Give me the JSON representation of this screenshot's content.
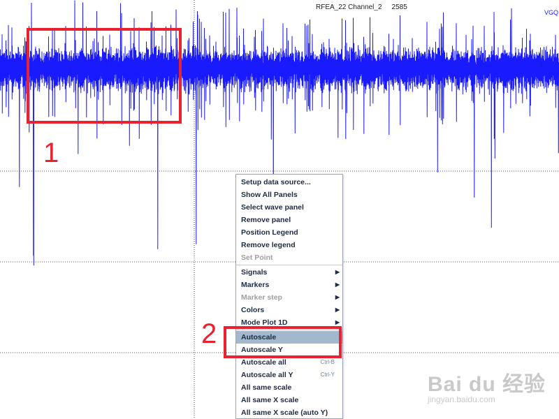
{
  "plot": {
    "title_left": "RFEA_22 Channel_2",
    "title_right": "2585",
    "wave_label": "VGQ",
    "wave_color": "#1a1aff"
  },
  "annotations": {
    "box1_number": "1",
    "box2_number": "2",
    "color": "#e8232f"
  },
  "menu": {
    "items": [
      {
        "label": "Setup data source...",
        "disabled": false
      },
      {
        "label": "Show All Panels",
        "disabled": false
      },
      {
        "label": "Select wave panel",
        "disabled": false
      },
      {
        "label": "Remove panel",
        "disabled": false
      },
      {
        "label": "Position Legend",
        "disabled": false
      },
      {
        "label": "Remove legend",
        "disabled": false
      },
      {
        "label": "Set Point",
        "disabled": true
      },
      {
        "label": "Signals",
        "submenu": true
      },
      {
        "label": "Markers",
        "submenu": true
      },
      {
        "label": "Marker step",
        "submenu": true,
        "disabled": true
      },
      {
        "label": "Colors",
        "submenu": true
      },
      {
        "label": "Mode Plot 1D",
        "submenu": true
      },
      {
        "label": "Autoscale",
        "highlighted": true
      },
      {
        "label": "Autoscale Y"
      },
      {
        "label": "Autoscale all",
        "shortcut": "Ctrl-B"
      },
      {
        "label": "Autoscale all Y",
        "shortcut": "Ctrl-Y"
      },
      {
        "label": "All same scale"
      },
      {
        "label": "All same X scale"
      },
      {
        "label": "All same X scale (auto Y)"
      }
    ],
    "arrow_glyph": "▶"
  },
  "watermark": {
    "brand": "Bai du 经验",
    "url": "jingyan.baidu.com"
  }
}
